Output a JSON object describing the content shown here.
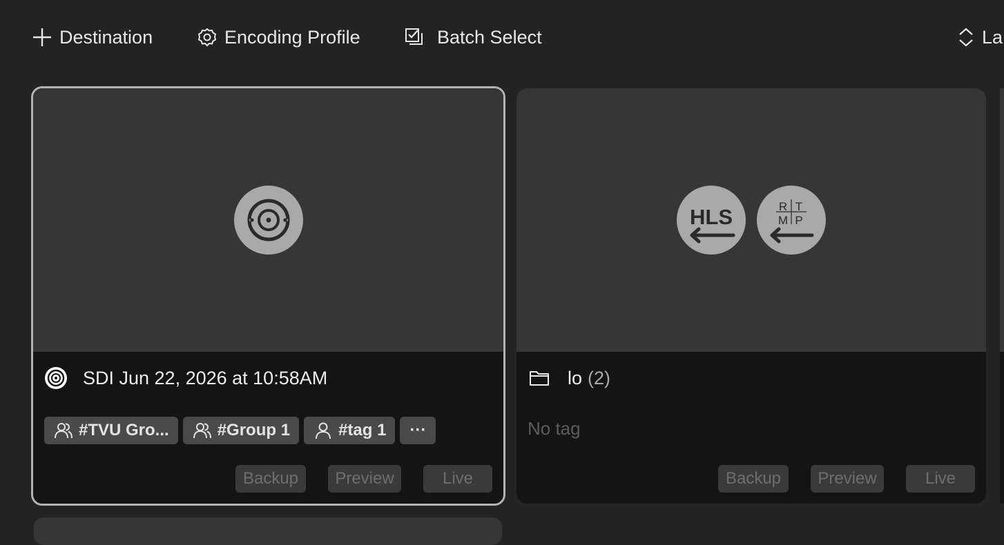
{
  "toolbar": {
    "destination_label": "Destination",
    "encoding_profile_label": "Encoding Profile",
    "batch_select_label": "Batch Select",
    "layout_label": "La"
  },
  "cards": [
    {
      "title": "SDI Jun 22, 2026 at 10:58AM",
      "title_icon": "sdi-source-icon",
      "thumbnail_icons": [
        "sdi-source-icon"
      ],
      "selected": true,
      "tags": [
        {
          "icon": "group-icon",
          "label": "#TVU Gro..."
        },
        {
          "icon": "group-icon",
          "label": "#Group 1"
        },
        {
          "icon": "person-icon",
          "label": "#tag 1"
        }
      ],
      "more_label": "···",
      "actions": {
        "backup": "Backup",
        "preview": "Preview",
        "live": "Live"
      }
    },
    {
      "title": "lo",
      "count": "(2)",
      "title_icon": "folder-icon",
      "thumbnail_icons": [
        "hls-input-icon",
        "rtmp-input-icon"
      ],
      "selected": false,
      "no_tag_label": "No tag",
      "actions": {
        "backup": "Backup",
        "preview": "Preview",
        "live": "Live"
      }
    }
  ],
  "colors": {
    "background": "#232323",
    "card_body": "#141414",
    "thumbnail": "#363636",
    "selected_border": "#b3b3b3",
    "tag_bg": "#4a4a4a",
    "icon_circle": "#a9a9a9"
  }
}
